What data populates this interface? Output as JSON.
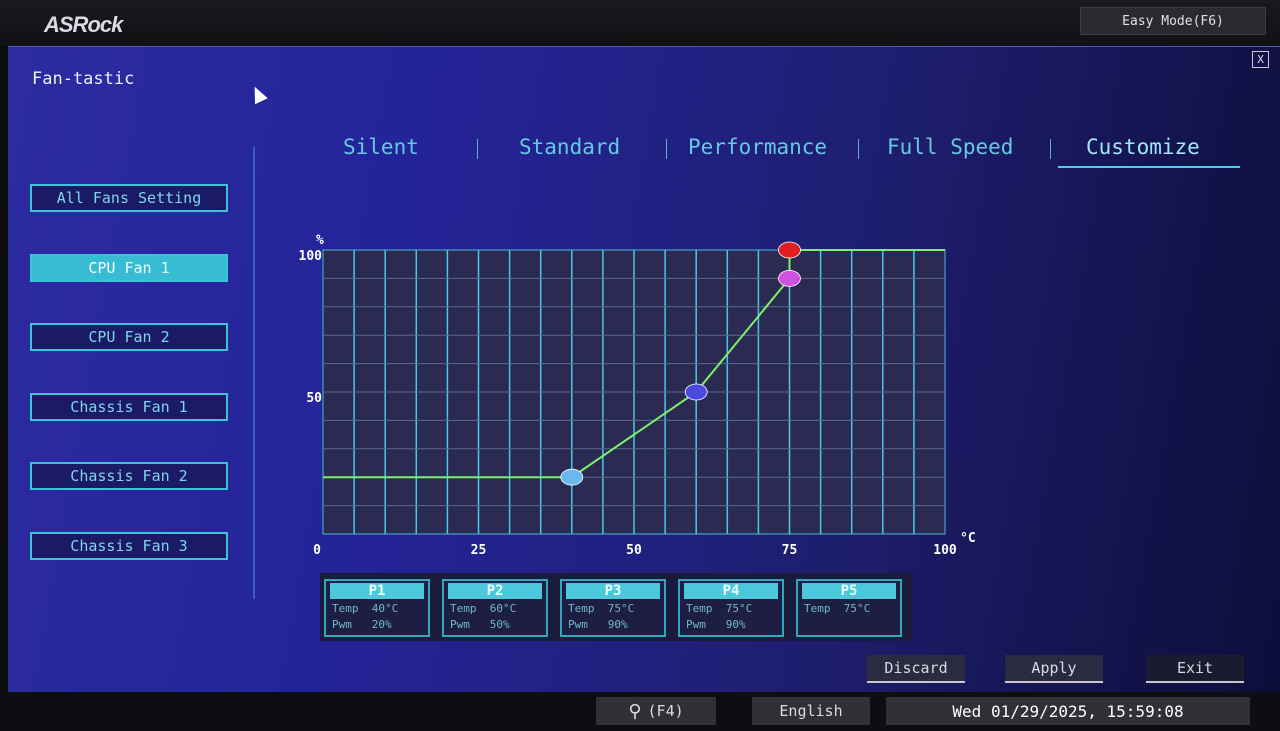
{
  "header": {
    "logo": "ASRock",
    "easy_mode": "Easy Mode(F6)"
  },
  "page": {
    "title": "Fan-tastic",
    "close": "X"
  },
  "fans": [
    {
      "label": "All Fans Setting"
    },
    {
      "label": "CPU Fan 1",
      "active": true
    },
    {
      "label": "CPU Fan 2"
    },
    {
      "label": "Chassis Fan 1"
    },
    {
      "label": "Chassis Fan 2"
    },
    {
      "label": "Chassis Fan 3"
    }
  ],
  "tabs": [
    {
      "label": "Silent"
    },
    {
      "label": "Standard"
    },
    {
      "label": "Performance"
    },
    {
      "label": "Full Speed"
    },
    {
      "label": "Customize",
      "active": true
    }
  ],
  "points": [
    {
      "name": "P1",
      "temp_label": "Temp",
      "temp": "40°C",
      "pwm_label": "Pwm",
      "pwm": "20%"
    },
    {
      "name": "P2",
      "temp_label": "Temp",
      "temp": "60°C",
      "pwm_label": "Pwm",
      "pwm": "50%"
    },
    {
      "name": "P3",
      "temp_label": "Temp",
      "temp": "75°C",
      "pwm_label": "Pwm",
      "pwm": "90%"
    },
    {
      "name": "P4",
      "temp_label": "Temp",
      "temp": "75°C",
      "pwm_label": "Pwm",
      "pwm": "90%"
    },
    {
      "name": "P5",
      "temp_label": "Temp",
      "temp": "75°C"
    }
  ],
  "chart_data": {
    "type": "line",
    "xlabel": "°C",
    "ylabel": "%",
    "xlim": [
      0,
      100
    ],
    "ylim": [
      0,
      100
    ],
    "xticks": [
      "0",
      "25",
      "50",
      "75",
      "100"
    ],
    "yticks": [
      "0",
      "50",
      "100"
    ],
    "grid": true,
    "curve": [
      [
        0,
        20
      ],
      [
        40,
        20
      ],
      [
        60,
        50
      ],
      [
        75,
        90
      ],
      [
        75,
        100
      ],
      [
        100,
        100
      ]
    ],
    "markers": [
      {
        "x": 40,
        "y": 20,
        "color": "#6ab8f0"
      },
      {
        "x": 60,
        "y": 50,
        "color": "#4a4ae0"
      },
      {
        "x": 75,
        "y": 90,
        "color": "#d050e0"
      },
      {
        "x": 75,
        "y": 100,
        "color": "#e02020"
      }
    ],
    "line_color": "#7cf06a"
  },
  "actions": {
    "discard": "Discard",
    "apply": "Apply",
    "exit": "Exit"
  },
  "footer": {
    "search": "(F4)",
    "language": "English",
    "datetime": "Wed 01/29/2025, 15:59:08"
  }
}
